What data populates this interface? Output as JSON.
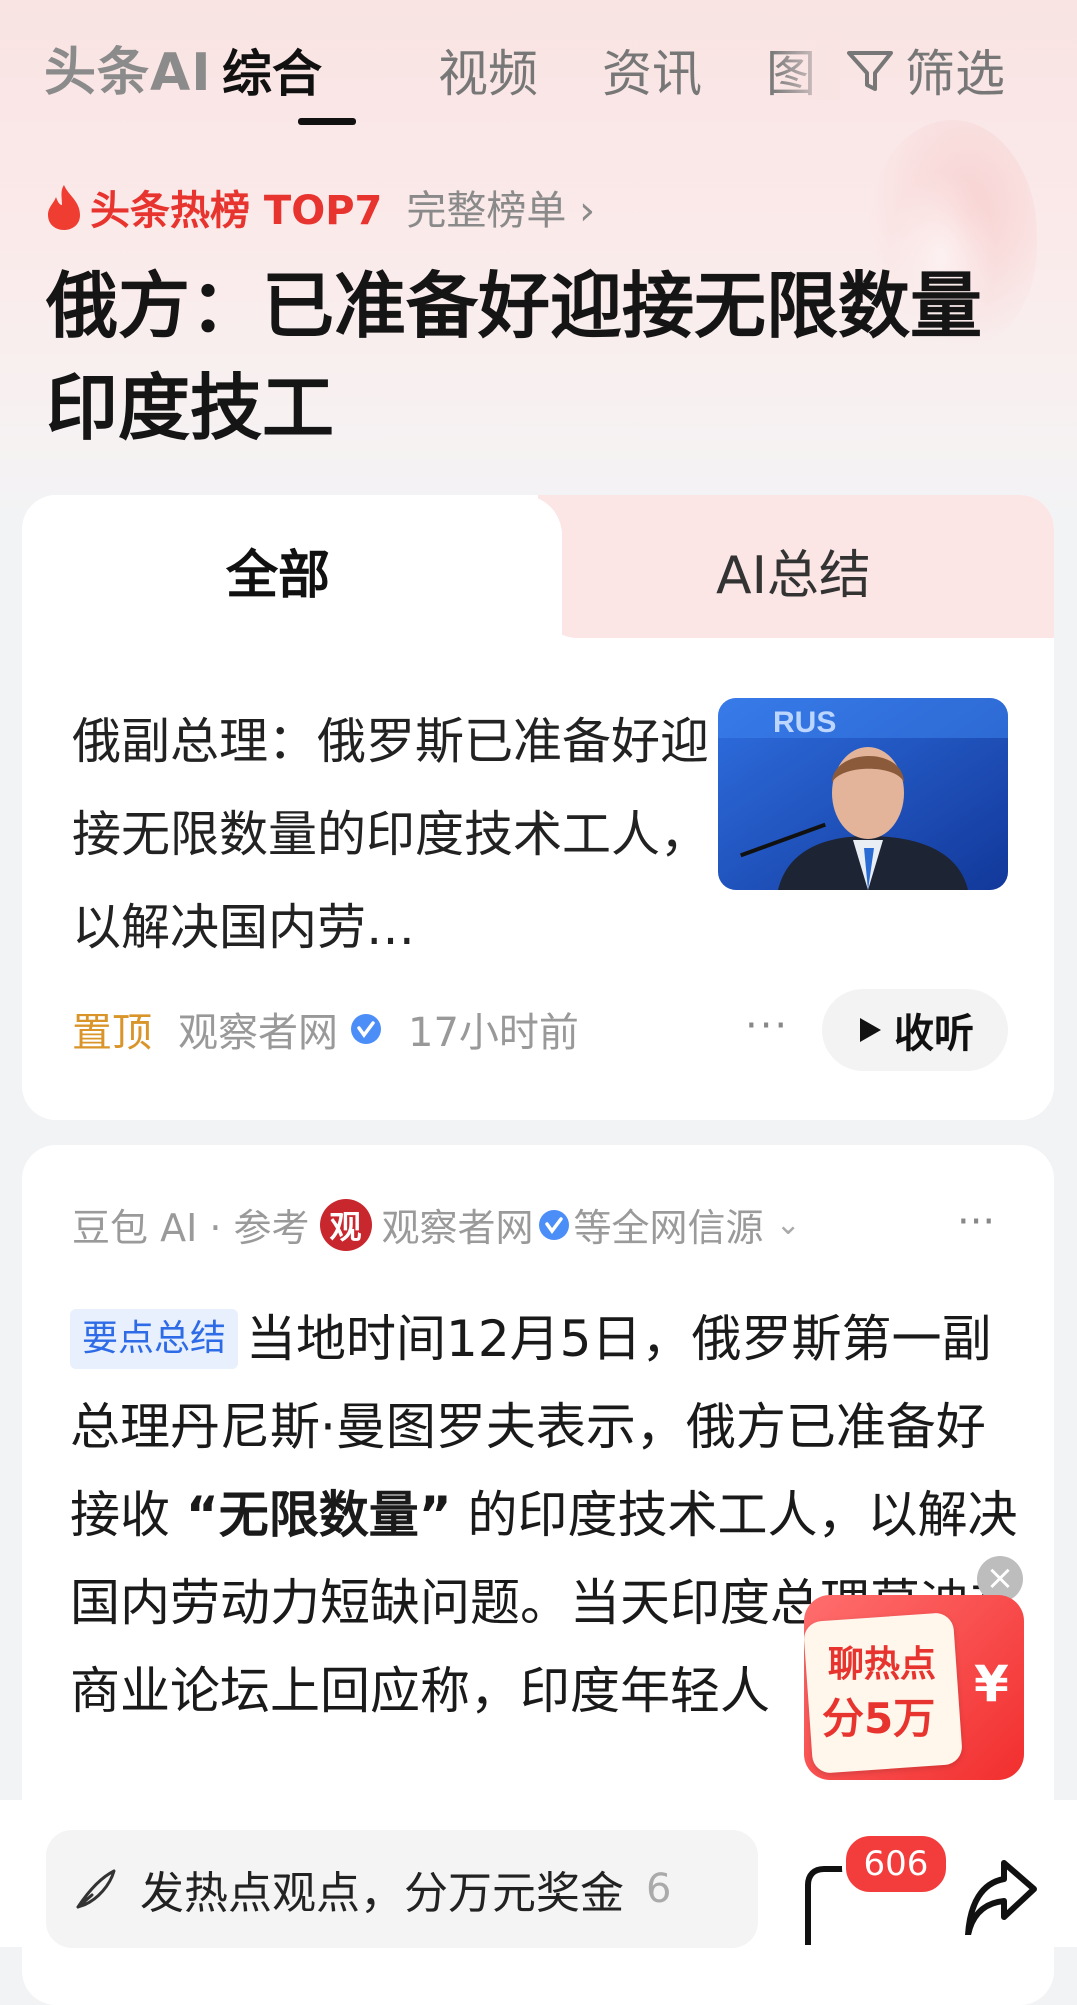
{
  "header": {
    "brand": "头条AI",
    "tabs": [
      "综合",
      "视频",
      "资讯",
      "图"
    ],
    "active_tab": "综合",
    "filter_label": "筛选"
  },
  "hot": {
    "title": "头条热榜 TOP7",
    "more": "完整榜单 ›"
  },
  "headline": "俄方：已准备好迎接无限数量印度技工",
  "segments": {
    "all": "全部",
    "ai": "AI总结",
    "active": "全部"
  },
  "article": {
    "text": "俄副总理：俄罗斯已准备好迎接无限数量的印度技术工人，以解决国内劳…",
    "pin": "置顶",
    "source": "观察者网",
    "time": "17小时前",
    "more": "···",
    "listen": "收听"
  },
  "ai_summary": {
    "source_prefix": "豆包 AI · 参考",
    "logo_text": "观",
    "source": "观察者网",
    "source_suffix": "等全网信源",
    "expand": "⌄",
    "more": "···",
    "tag": "要点总结",
    "text_part1": "当地时间12月5日，俄罗斯第一副总理丹尼斯·曼图罗夫表示，俄方已准备好接收",
    "text_bold": "“无限数量”",
    "text_part2": "的印度技术工人，以解决国内劳动力短缺问题。当天印度总理莫迪在商业论坛上回应称，印度年轻人"
  },
  "promo": {
    "close": "×",
    "line1": "聊热点",
    "line2": "分5万",
    "currency": "¥"
  },
  "bottom": {
    "comment_placeholder": "发热点观点，分万元奖金",
    "comment_count": "6",
    "badge": "606"
  },
  "colors": {
    "accent_red": "#e8342f",
    "pin_orange": "#d9952a",
    "tag_blue": "#2e6be6",
    "verified_blue": "#4c8ef7"
  },
  "icons": [
    "fire-icon",
    "filter-icon",
    "verified-icon",
    "play-icon",
    "pen-icon",
    "comment-icon",
    "share-icon",
    "chevron-down-icon",
    "close-icon"
  ]
}
